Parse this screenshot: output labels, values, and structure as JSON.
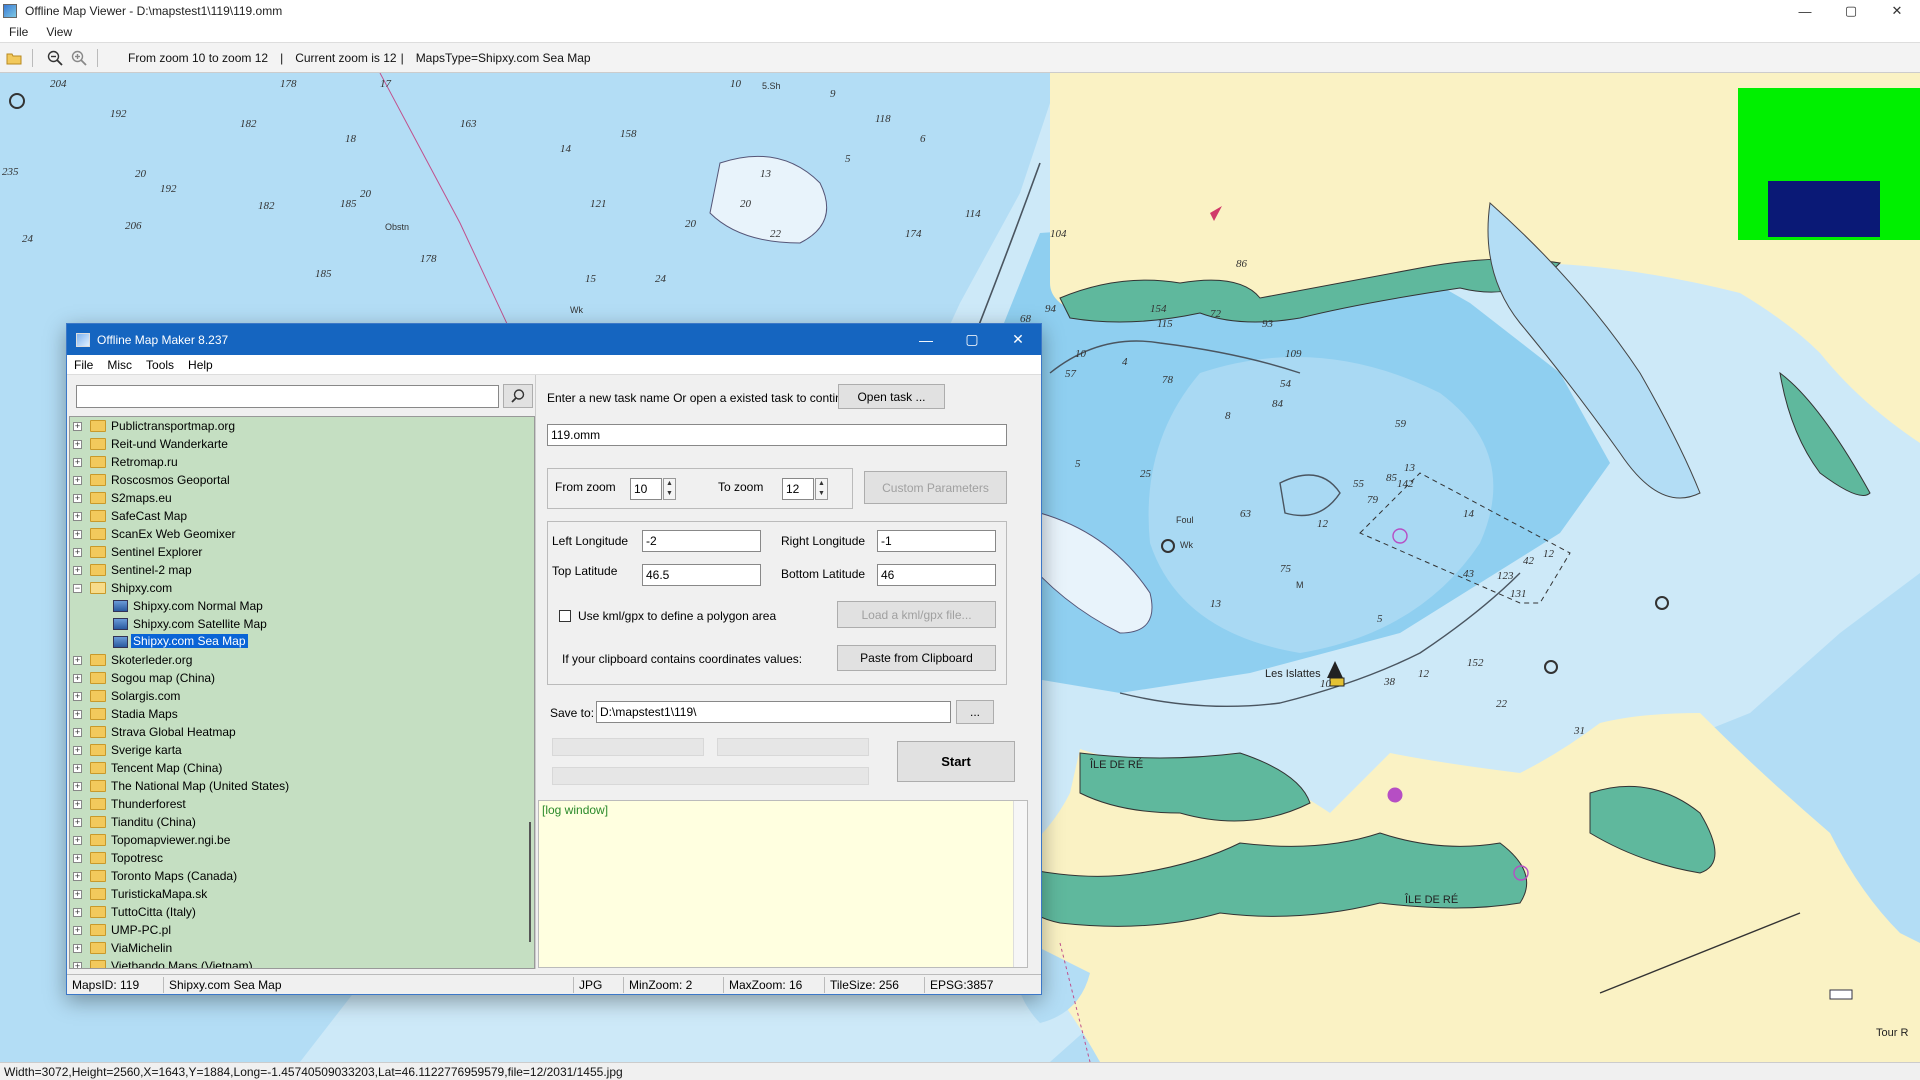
{
  "window": {
    "title": "Offline Map Viewer - D:\\mapstest1\\119\\119.omm",
    "menu": [
      "File",
      "View"
    ],
    "controls": {
      "minimize": "—",
      "maximize": "▢",
      "close": "✕"
    }
  },
  "toolbar": {
    "zoom_range": "From zoom 10 to zoom 12",
    "current_zoom": "Current zoom is 12",
    "maps_type": "MapsType=Shipxy.com Sea Map",
    "separator": "|"
  },
  "map": {
    "places": [
      "Les Islattes",
      "ÎLE DE RÉ",
      "ÎLE DE RÉ",
      "Tour R"
    ],
    "soundings": [
      "204",
      "178",
      "17",
      "192",
      "182",
      "163",
      "158",
      "235",
      "20",
      "18",
      "14",
      "121",
      "192",
      "20",
      "185",
      "206",
      "182",
      "178",
      "24",
      "185",
      "15",
      "24",
      "20",
      "10",
      "9",
      "118",
      "6",
      "5",
      "13",
      "22",
      "20",
      "174",
      "114",
      "104",
      "94",
      "154",
      "115",
      "86",
      "72",
      "68",
      "57",
      "10",
      "78",
      "84",
      "109",
      "59",
      "63",
      "4",
      "93",
      "8",
      "12",
      "55",
      "54",
      "85",
      "12",
      "13",
      "42",
      "142",
      "131",
      "14",
      "75",
      "79",
      "5",
      "43",
      "123",
      "152",
      "38",
      "12",
      "22",
      "31",
      "5",
      "25",
      "13",
      "10"
    ],
    "small_notes": [
      "Obstn",
      "Wk",
      "Foul",
      "Wk",
      "5.Sh",
      "M"
    ],
    "minimap_colors": {
      "background": "#00f000",
      "viewport": "#0a1976"
    }
  },
  "dialog": {
    "title": "Offline Map Maker 8.237",
    "menu": [
      "File",
      "Misc",
      "Tools",
      "Help"
    ],
    "search_placeholder": "",
    "tree": [
      {
        "label": "Publictransportmap.org"
      },
      {
        "label": "Reit-und Wanderkarte"
      },
      {
        "label": "Retromap.ru"
      },
      {
        "label": "Roscosmos Geoportal"
      },
      {
        "label": "S2maps.eu"
      },
      {
        "label": "SafeCast Map"
      },
      {
        "label": "ScanEx Web Geomixer"
      },
      {
        "label": "Sentinel Explorer"
      },
      {
        "label": "Sentinel-2 map"
      },
      {
        "label": "Shipxy.com"
      },
      {
        "label": "Shipxy.com Normal Map"
      },
      {
        "label": "Shipxy.com Satellite Map"
      },
      {
        "label": "Shipxy.com Sea Map"
      },
      {
        "label": "Skoterleder.org"
      },
      {
        "label": "Sogou map (China)"
      },
      {
        "label": "Solargis.com"
      },
      {
        "label": "Stadia Maps"
      },
      {
        "label": "Strava Global Heatmap"
      },
      {
        "label": "Sverige karta"
      },
      {
        "label": "Tencent Map (China)"
      },
      {
        "label": "The National Map (United States)"
      },
      {
        "label": "Thunderforest"
      },
      {
        "label": "Tianditu (China)"
      },
      {
        "label": "Topomapviewer.ngi.be"
      },
      {
        "label": "Topotresc"
      },
      {
        "label": "Toronto Maps (Canada)"
      },
      {
        "label": "TuristickaMapa.sk"
      },
      {
        "label": "TuttoCitta (Italy)"
      },
      {
        "label": "UMP-PC.pl"
      },
      {
        "label": "ViaMichelin"
      },
      {
        "label": "Vietbando Maps (Vietnam)"
      }
    ],
    "task_prompt": "Enter a new task name Or open a existed task to continue:",
    "open_task_button": "Open task ...",
    "task_name": "119.omm",
    "from_zoom_label": "From zoom",
    "from_zoom_value": "10",
    "to_zoom_label": "To zoom",
    "to_zoom_value": "12",
    "custom_params_button": "Custom Parameters",
    "left_lon_label": "Left Longitude",
    "left_lon_value": "-2",
    "right_lon_label": "Right Longitude",
    "right_lon_value": "-1",
    "top_lat_label": "Top Latitude",
    "top_lat_value": "46.5",
    "bottom_lat_label": "Bottom Latitude",
    "bottom_lat_value": "46",
    "kml_checkbox_label": "Use kml/gpx to define a polygon area",
    "load_kml_button": "Load a kml/gpx file...",
    "clipboard_label": "If your clipboard contains coordinates values:",
    "paste_button": "Paste from Clipboard",
    "save_to_label": "Save to:",
    "save_to_value": "D:\\mapstest1\\119\\",
    "browse_button": "...",
    "start_button": "Start",
    "log_text": "[log window]",
    "status": {
      "maps_id": "MapsID: 119",
      "map_name": "Shipxy.com Sea Map",
      "format": "JPG",
      "min_zoom": "MinZoom: 2",
      "max_zoom": "MaxZoom: 16",
      "tile_size": "TileSize: 256",
      "epsg": "EPSG:3857"
    }
  },
  "statusbar": {
    "text": "Width=3072,Height=2560,X=1643,Y=1884,Long=-1.45740509033203,Lat=46.1122776959579,file=12/2031/1455.jpg"
  }
}
